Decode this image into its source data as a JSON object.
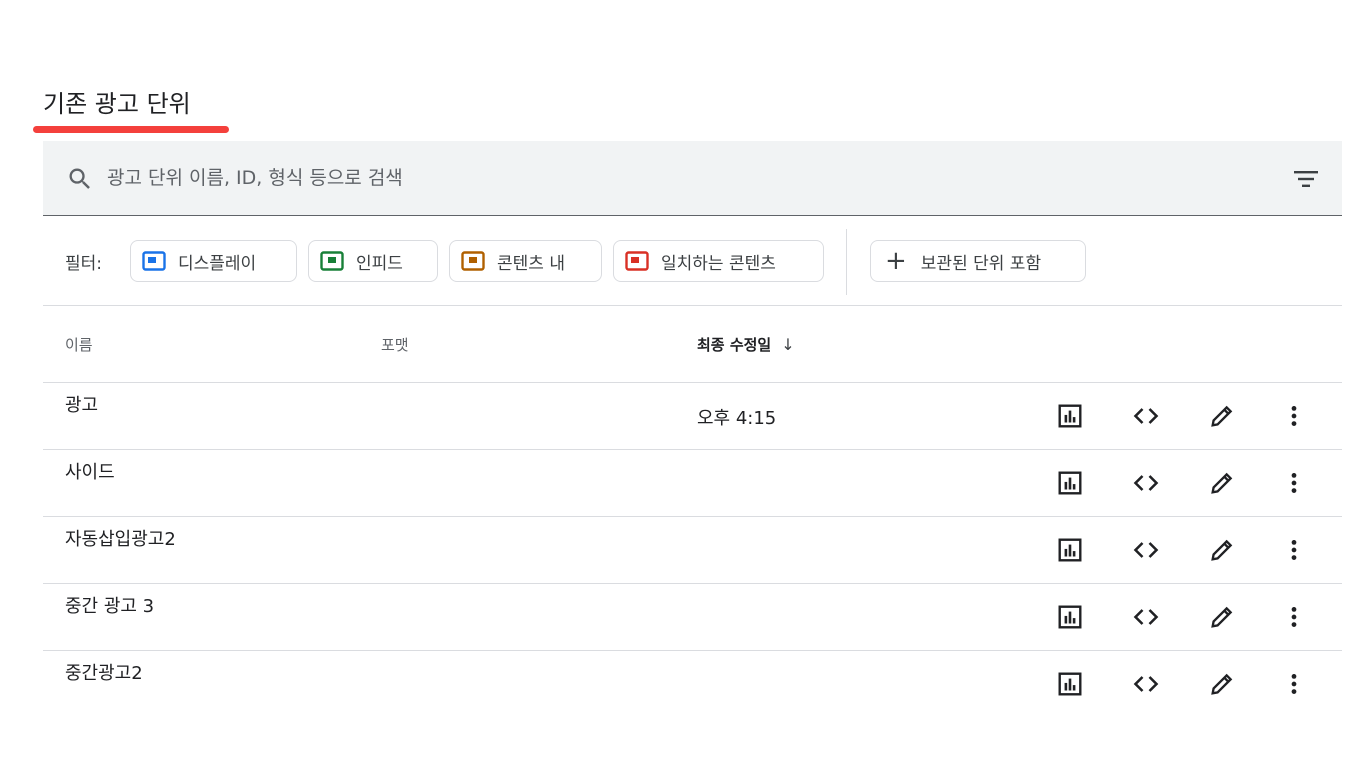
{
  "section": {
    "title": "기존 광고 단위"
  },
  "search": {
    "placeholder": "광고 단위 이름, ID, 형식 등으로 검색"
  },
  "filters": {
    "label": "필터:",
    "chips": [
      {
        "label": "디스플레이",
        "color": "#1a73e8"
      },
      {
        "label": "인피드",
        "color": "#188038"
      },
      {
        "label": "콘텐츠 내",
        "color": "#b06000"
      },
      {
        "label": "일치하는 콘텐츠",
        "color": "#d93025"
      }
    ],
    "archived_label": "보관된 단위 포함"
  },
  "table": {
    "headers": {
      "name": "이름",
      "format": "포맷",
      "modified": "최종 수정일"
    },
    "rows": [
      {
        "name": "광고",
        "modified": "오후 4:15"
      },
      {
        "name": "사이드",
        "modified": ""
      },
      {
        "name": "자동삽입광고2",
        "modified": ""
      },
      {
        "name": "중간 광고 3",
        "modified": ""
      },
      {
        "name": "중간광고2",
        "modified": ""
      }
    ]
  },
  "colors": {
    "accent_underline": "#f4403c",
    "search_bg": "#f1f3f4"
  }
}
